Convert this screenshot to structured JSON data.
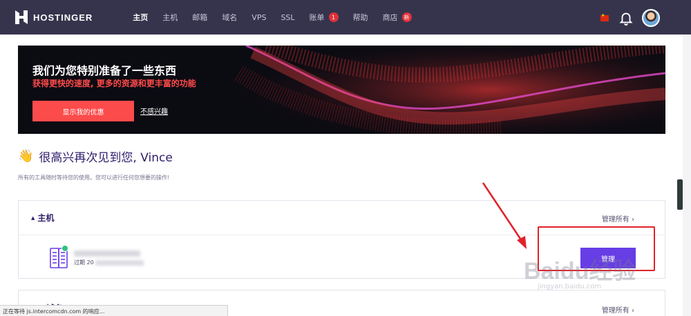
{
  "nav": {
    "brand": "HOSTINGER",
    "items": [
      {
        "label": "主页",
        "active": true
      },
      {
        "label": "主机"
      },
      {
        "label": "邮箱"
      },
      {
        "label": "域名"
      },
      {
        "label": "VPS"
      },
      {
        "label": "SSL"
      },
      {
        "label": "账单",
        "badge": "1"
      },
      {
        "label": "帮助"
      },
      {
        "label": "商店",
        "badge": "新"
      }
    ],
    "icons": [
      "china-flag-icon",
      "bell-icon",
      "avatar"
    ]
  },
  "banner": {
    "title": "我们为您特别准备了一些东西",
    "subtitle": "获得更快的速度, 更多的资源和更丰富的功能",
    "cta_label": "显示我的优惠",
    "dismiss_label": "不感兴趣"
  },
  "greeting": {
    "icon": "waving-hand-icon",
    "title": "很高兴再次见到您, Vince",
    "subtitle": "所有的工具随时等待您的使用。您可以进行任何您想要的操作!"
  },
  "hosting_card": {
    "title": "主机",
    "manage_all": "管理所有 ›",
    "expiry_prefix": "过期 20",
    "manage_label": "管理"
  },
  "second_card": {
    "title": "域名",
    "manage_all": "管理所有 ›"
  },
  "status_bar": "正在等待 js.intercomcdn.com 的响应...",
  "watermark": {
    "main": "Baidu经验",
    "sub": "jingyan.baidu.com"
  },
  "colors": {
    "nav_bg": "#36344d",
    "accent_purple": "#673de6",
    "cta_red": "#fc4b4b",
    "annotation_red": "#e0222a"
  }
}
